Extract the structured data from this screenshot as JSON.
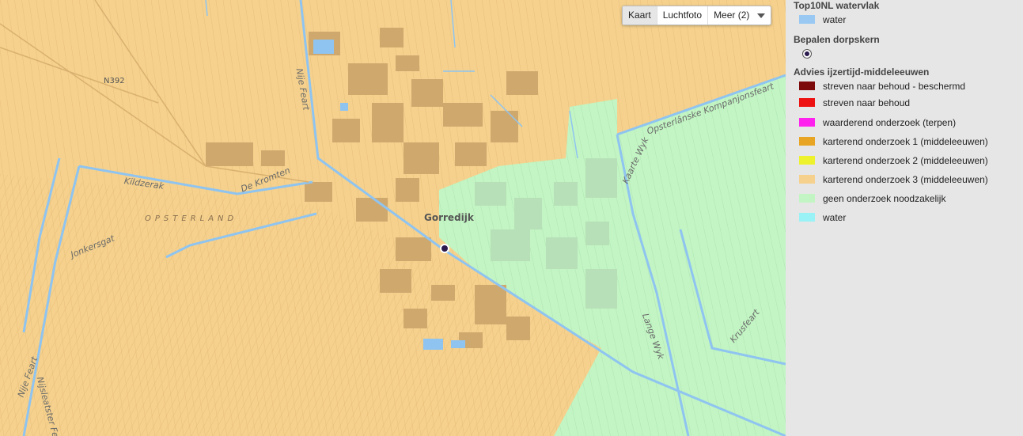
{
  "map": {
    "map_type_buttons": [
      "Kaart",
      "Luchtfoto",
      "Meer (2)"
    ],
    "active_map_type": "Kaart",
    "labels": {
      "place": "Gorredijk",
      "region": "OPSTERLAND",
      "road": "N392",
      "waterways": [
        "Nije Feart",
        "Kildzerak",
        "De Kromten",
        "Jonkersgat",
        "Nije Feart",
        "Nijsleatster Feart",
        "Opsterlânske Kompanjonsfeart",
        "Kaarte Wyk",
        "Lange Wyk",
        "Krusfeart"
      ]
    },
    "colors": {
      "base_area": "#f5d18d",
      "green_zone": "#c2f5c3",
      "water": "#8fc4f0",
      "built_up": "#cfa86e"
    }
  },
  "legend": {
    "groups": [
      {
        "title": "Top10NL watervlak",
        "items": [
          {
            "label": "water",
            "color": "#99c8f2"
          }
        ]
      },
      {
        "title": "Bepalen dorpskern",
        "items": [
          {
            "label": "",
            "icon": "dot-marker-icon"
          }
        ]
      },
      {
        "title": "Advies ijzertijd-middeleeuwen",
        "items": [
          {
            "label": "streven naar behoud - beschermd",
            "color": "#7c0a0a"
          },
          {
            "label": "streven naar behoud",
            "color": "#ee1111"
          },
          {
            "label": "waarderend onderzoek (terpen)",
            "color": "#ff22ee"
          },
          {
            "label": "karterend onderzoek 1 (middeleeuwen)",
            "color": "#e8a524"
          },
          {
            "label": "karterend onderzoek 2 (middeleeuwen)",
            "color": "#eef22c"
          },
          {
            "label": "karterend onderzoek 3 (middeleeuwen)",
            "color": "#f5d18d"
          },
          {
            "label": "geen onderzoek noodzakelijk",
            "color": "#c2f5c3"
          },
          {
            "label": "water",
            "color": "#99f2f5"
          }
        ]
      }
    ]
  }
}
